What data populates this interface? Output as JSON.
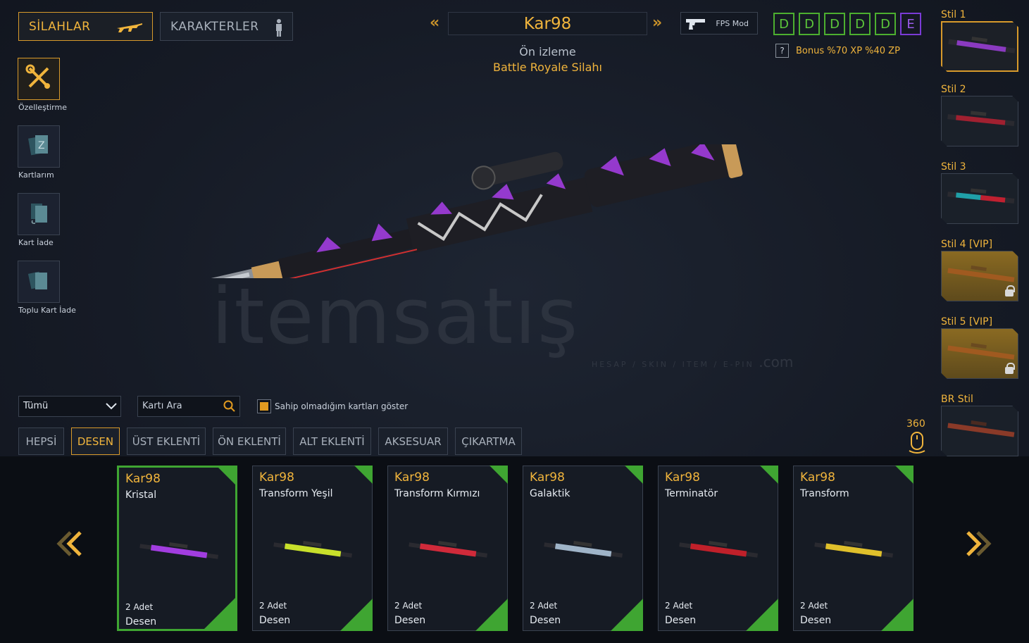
{
  "tabs": {
    "weapons": "SİLAHLAR",
    "characters": "KARAKTERLER"
  },
  "tools": [
    {
      "label": "Özelleştirme",
      "icon": "wrench-screwdriver-icon"
    },
    {
      "label": "Kartlarım",
      "icon": "card-icon"
    },
    {
      "label": "Kart İade",
      "icon": "card-return-icon"
    },
    {
      "label": "Toplu Kart İade",
      "icon": "cards-stack-icon"
    }
  ],
  "title": {
    "weapon": "Kar98",
    "preview": "Ön izleme",
    "category": "Battle Royale Silahı"
  },
  "fps_mode": "FPS Mod",
  "grades": [
    "D",
    "D",
    "D",
    "D",
    "D",
    "E"
  ],
  "bonus": {
    "help": "?",
    "text": "Bonus %70 XP %40 ZP"
  },
  "styles": [
    {
      "label": "Stil 1",
      "active": true
    },
    {
      "label": "Stil 2"
    },
    {
      "label": "Stil 3"
    },
    {
      "label": "Stil 4 [VIP]",
      "locked": true
    },
    {
      "label": "Stil 5 [VIP]",
      "locked": true
    },
    {
      "label": "BR Stil"
    }
  ],
  "filters": {
    "select_value": "Tümü",
    "search_placeholder": "Kartı Ara",
    "checkbox_label": "Sahip olmadığım kartları göster",
    "tabs": [
      "HEPSİ",
      "DESEN",
      "ÜST EKLENTİ",
      "ÖN EKLENTİ",
      "ALT EKLENTİ",
      "AKSESUAR",
      "ÇIKARTMA"
    ],
    "active_tab": "DESEN"
  },
  "rotate": "360",
  "watermark": {
    "brand": "itemsatış",
    "tagline": "HESAP / SKIN / ITEM / E-PIN",
    "domain": ".com"
  },
  "cards": [
    {
      "weapon": "Kar98",
      "skin": "Kristal",
      "qty": "2 Adet",
      "type": "Desen",
      "color": "#a23de0"
    },
    {
      "weapon": "Kar98",
      "skin": "Transform Yeşil",
      "qty": "2 Adet",
      "type": "Desen",
      "color": "#c8e02b"
    },
    {
      "weapon": "Kar98",
      "skin": "Transform Kırmızı",
      "qty": "2 Adet",
      "type": "Desen",
      "color": "#d02a3a"
    },
    {
      "weapon": "Kar98",
      "skin": "Galaktik",
      "qty": "2 Adet",
      "type": "Desen",
      "color": "#9fb4c8"
    },
    {
      "weapon": "Kar98",
      "skin": "Terminatör",
      "qty": "2 Adet",
      "type": "Desen",
      "color": "#c0202a"
    },
    {
      "weapon": "Kar98",
      "skin": "Transform",
      "qty": "2 Adet",
      "type": "Desen",
      "color": "#e0c02b"
    }
  ]
}
